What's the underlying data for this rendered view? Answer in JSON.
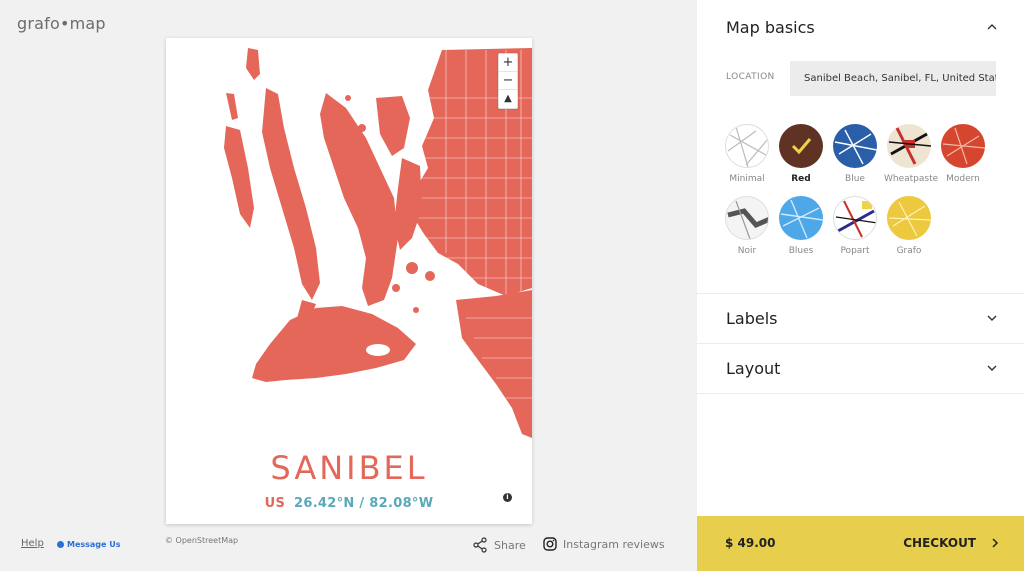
{
  "app": {
    "logo": "grafo•map"
  },
  "poster": {
    "city": "SANIBEL",
    "country": "US",
    "coordinates": "26.42°N / 82.08°W",
    "zoom_in": "+",
    "zoom_out": "−",
    "compass": "▲"
  },
  "footer": {
    "osm": "© OpenStreetMap",
    "help": "Help",
    "message": "Message Us",
    "share": "Share",
    "instagram": "Instagram reviews"
  },
  "panel": {
    "map_basics": "Map basics",
    "location_label": "LOCATION",
    "location_value": "Sanibel Beach, Sanibel, FL, United States",
    "styles": [
      {
        "label": "Minimal"
      },
      {
        "label": "Red",
        "selected": true
      },
      {
        "label": "Blue"
      },
      {
        "label": "Wheatpaste"
      },
      {
        "label": "Modern"
      },
      {
        "label": "Noir"
      },
      {
        "label": "Blues"
      },
      {
        "label": "Popart"
      },
      {
        "label": "Grafo"
      }
    ],
    "labels_section": "Labels",
    "layout_section": "Layout"
  },
  "checkout": {
    "price": "$ 49.00",
    "label": "CHECKOUT"
  },
  "colors": {
    "map_red": "#e4675a",
    "coord_teal": "#5aa9b8",
    "checkout_yellow": "#e7cf4d"
  }
}
